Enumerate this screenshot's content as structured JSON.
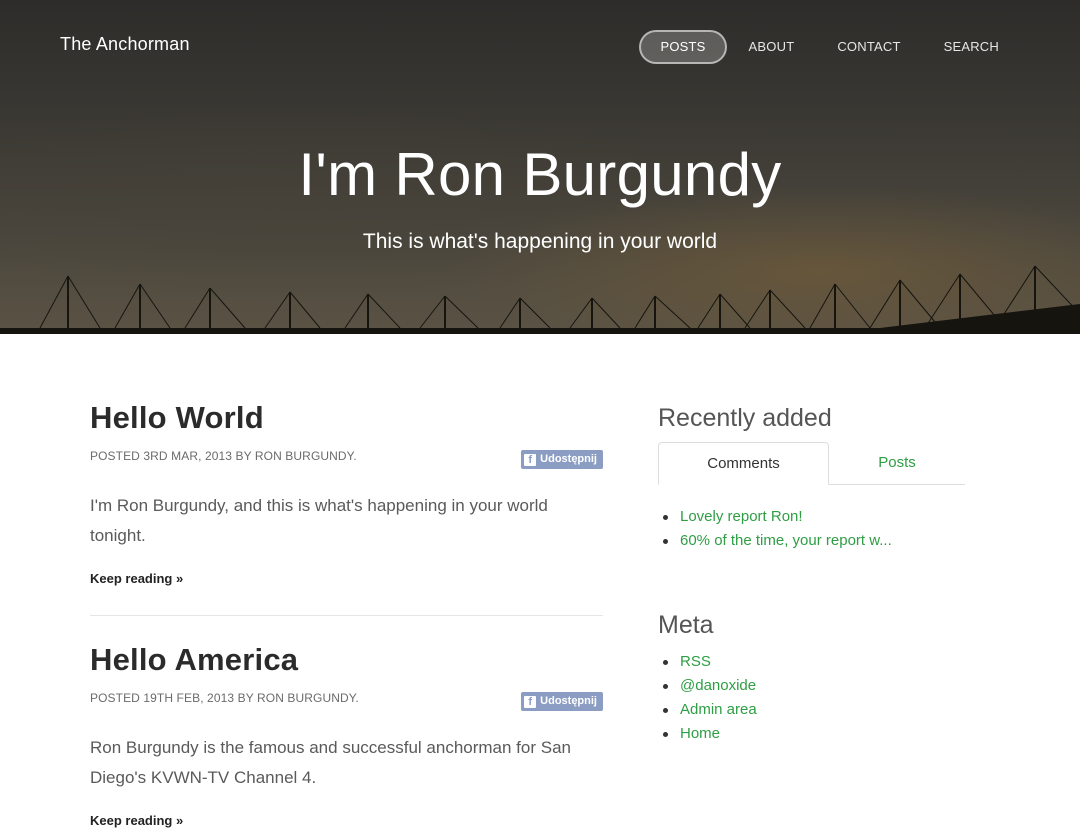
{
  "header": {
    "brand": "The Anchorman",
    "nav": [
      "POSTS",
      "ABOUT",
      "CONTACT",
      "SEARCH"
    ],
    "title": "I'm Ron Burgundy",
    "subtitle": "This is what's happening in your world"
  },
  "posts": [
    {
      "title": "Hello World",
      "meta": "POSTED 3RD MAR, 2013 BY RON BURGUNDY.",
      "share_label": "Udostępnij",
      "excerpt": "I'm Ron Burgundy, and this is what's happening in your world tonight.",
      "keep_reading": "Keep reading »"
    },
    {
      "title": "Hello America",
      "meta": "POSTED 19TH FEB, 2013 BY RON BURGUNDY.",
      "share_label": "Udostępnij",
      "excerpt": "Ron Burgundy is the famous and successful anchorman for San Diego's KVWN-TV Channel 4.",
      "keep_reading": "Keep reading »"
    }
  ],
  "sidebar": {
    "recent_title": "Recently added",
    "tabs": [
      "Comments",
      "Posts"
    ],
    "comments": [
      "Lovely report Ron!",
      "60% of the time, your report w..."
    ],
    "meta_title": "Meta",
    "meta_links": [
      "RSS",
      "@danoxide",
      "Admin area",
      "Home"
    ]
  },
  "colors": {
    "link_green": "#2e9e44",
    "share_blue": "#8b9dc3"
  }
}
